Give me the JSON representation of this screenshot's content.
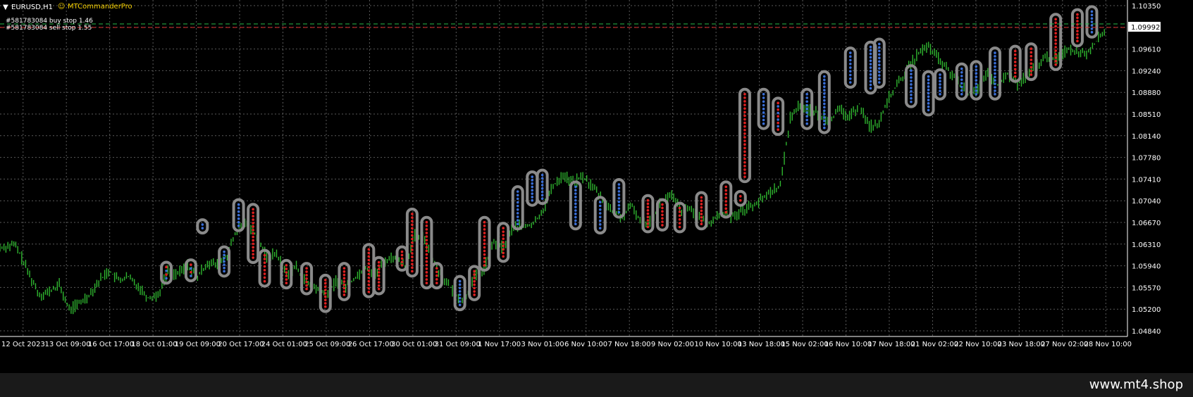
{
  "header": {
    "symbol_label": "EURUSD,H1",
    "ea_label": "MTCommanderPro",
    "ea_icon": "expert-advisor-face-icon"
  },
  "orders": [
    {
      "text": "#581783084 buy stop 1.46",
      "price": 1.1004,
      "color": "#27b84a"
    },
    {
      "text": "#581783084 sell stop 1.55",
      "price": 1.0998,
      "color": "#e03030"
    }
  ],
  "current_price": "1.09992",
  "watermark": "www.mt4.shop",
  "colors": {
    "background": "#000000",
    "grid": "#5a5a5a",
    "candle": "#2fb52f",
    "buy": "#3a6fd8",
    "sell": "#e02020",
    "marker_ring": "#8a8a8a"
  },
  "chart_data": {
    "type": "candlestick",
    "symbol": "EURUSD",
    "timeframe": "H1",
    "ylim": [
      1.0484,
      1.1035
    ],
    "y_ticks": [
      "1.10350",
      "1.09960",
      "1.09610",
      "1.09240",
      "1.08880",
      "1.08510",
      "1.08140",
      "1.07780",
      "1.07410",
      "1.07040",
      "1.06670",
      "1.06310",
      "1.05940",
      "1.05570",
      "1.05200",
      "1.04840"
    ],
    "x_ticks": [
      "12 Oct 2023",
      "13 Oct 09:00",
      "16 Oct 17:00",
      "18 Oct 01:00",
      "19 Oct 09:00",
      "20 Oct 17:00",
      "24 Oct 01:00",
      "25 Oct 09:00",
      "26 Oct 17:00",
      "30 Oct 01:00",
      "31 Oct 09:00",
      "1 Nov 17:00",
      "3 Nov 01:00",
      "6 Nov 10:00",
      "7 Nov 18:00",
      "9 Nov 02:00",
      "10 Nov 10:00",
      "13 Nov 18:00",
      "15 Nov 02:00",
      "16 Nov 10:00",
      "17 Nov 18:00",
      "21 Nov 02:00",
      "22 Nov 10:00",
      "23 Nov 18:00",
      "27 Nov 02:00",
      "28 Nov 10:00"
    ],
    "price_path": [
      [
        0,
        1.0625
      ],
      [
        2,
        1.0615
      ],
      [
        1.5,
        1.063
      ],
      [
        3,
        1.0578
      ],
      [
        4,
        1.0545
      ],
      [
        5,
        1.055
      ],
      [
        6,
        1.0562
      ],
      [
        7,
        1.052
      ],
      [
        8,
        1.053
      ],
      [
        9,
        1.0545
      ],
      [
        10,
        1.0568
      ],
      [
        11,
        1.0586
      ],
      [
        12,
        1.057
      ],
      [
        13,
        1.0575
      ],
      [
        14,
        1.056
      ],
      [
        15,
        1.054
      ],
      [
        16,
        1.0545
      ],
      [
        17,
        1.0585
      ],
      [
        18,
        1.058
      ],
      [
        19,
        1.0595
      ],
      [
        20,
        1.0575
      ],
      [
        21,
        1.06
      ],
      [
        22,
        1.0595
      ],
      [
        23,
        1.0612
      ],
      [
        24,
        1.0655
      ],
      [
        25,
        1.0668
      ],
      [
        26,
        1.0645
      ],
      [
        27,
        1.0608
      ],
      [
        28,
        1.0615
      ],
      [
        29,
        1.058
      ],
      [
        30,
        1.0592
      ],
      [
        31,
        1.0565
      ],
      [
        32,
        1.0555
      ],
      [
        33,
        1.0543
      ],
      [
        34,
        1.0568
      ],
      [
        35,
        1.056
      ],
      [
        36,
        1.0575
      ],
      [
        37,
        1.0592
      ],
      [
        38,
        1.058
      ],
      [
        39,
        1.0603
      ],
      [
        40,
        1.061
      ],
      [
        41,
        1.0595
      ],
      [
        42,
        1.0645
      ],
      [
        43,
        1.064
      ],
      [
        44,
        1.0598
      ],
      [
        45,
        1.057
      ],
      [
        46,
        1.0548
      ],
      [
        47,
        1.0535
      ],
      [
        48,
        1.0575
      ],
      [
        49,
        1.0588
      ],
      [
        50,
        1.0635
      ],
      [
        51,
        1.0625
      ],
      [
        52,
        1.0662
      ],
      [
        53,
        1.066
      ],
      [
        54,
        1.0665
      ],
      [
        55,
        1.069
      ],
      [
        56,
        1.073
      ],
      [
        57,
        1.0748
      ],
      [
        58,
        1.0735
      ],
      [
        59,
        1.0745
      ],
      [
        60,
        1.0728
      ],
      [
        61,
        1.0708
      ],
      [
        62,
        1.0685
      ],
      [
        63,
        1.0678
      ],
      [
        64,
        1.0695
      ],
      [
        65,
        1.0665
      ],
      [
        66,
        1.0673
      ],
      [
        67,
        1.0705
      ],
      [
        68,
        1.0712
      ],
      [
        69,
        1.0688
      ],
      [
        70,
        1.069
      ],
      [
        71,
        1.067
      ],
      [
        72,
        1.0668
      ],
      [
        73,
        1.0684
      ],
      [
        74,
        1.0678
      ],
      [
        75,
        1.0686
      ],
      [
        76,
        1.0695
      ],
      [
        77,
        1.0705
      ],
      [
        78,
        1.072
      ],
      [
        79,
        1.073
      ],
      [
        80,
        1.0845
      ],
      [
        81,
        1.0868
      ],
      [
        82,
        1.0858
      ],
      [
        83,
        1.085
      ],
      [
        84,
        1.0842
      ],
      [
        85,
        1.0858
      ],
      [
        86,
        1.0845
      ],
      [
        87,
        1.0868
      ],
      [
        88,
        1.083
      ],
      [
        89,
        1.0835
      ],
      [
        90,
        1.088
      ],
      [
        91,
        1.0905
      ],
      [
        92,
        1.093
      ],
      [
        93,
        1.0955
      ],
      [
        94,
        1.0965
      ],
      [
        95,
        1.0945
      ],
      [
        96,
        1.0925
      ],
      [
        97,
        1.0905
      ],
      [
        98,
        1.0885
      ],
      [
        99,
        1.0895
      ],
      [
        100,
        1.0918
      ],
      [
        101,
        1.09
      ],
      [
        102,
        1.092
      ],
      [
        103,
        1.0902
      ],
      [
        104,
        1.0915
      ],
      [
        105,
        1.0935
      ],
      [
        106,
        1.0948
      ],
      [
        107,
        1.0945
      ],
      [
        108,
        1.0962
      ],
      [
        109,
        1.0958
      ],
      [
        110,
        1.0955
      ],
      [
        111,
        1.0975
      ],
      [
        112,
        1.0996
      ]
    ],
    "markers": [
      {
        "x": 11.5,
        "y1": 1.0573,
        "y2": 1.0592,
        "side": "mixed"
      },
      {
        "x": 13.2,
        "y1": 1.0577,
        "y2": 1.0596,
        "side": "mixed"
      },
      {
        "x": 14,
        "y1": 1.0658,
        "y2": 1.0664,
        "side": "buy"
      },
      {
        "x": 15.5,
        "y1": 1.0585,
        "y2": 1.0618,
        "side": "buy"
      },
      {
        "x": 16.5,
        "y1": 1.0662,
        "y2": 1.0698,
        "side": "buy"
      },
      {
        "x": 17.5,
        "y1": 1.0608,
        "y2": 1.069,
        "side": "sell"
      },
      {
        "x": 18.3,
        "y1": 1.0568,
        "y2": 1.0612,
        "side": "sell"
      },
      {
        "x": 19.8,
        "y1": 1.0565,
        "y2": 1.0595,
        "side": "sell"
      },
      {
        "x": 21.2,
        "y1": 1.0555,
        "y2": 1.059,
        "side": "sell"
      },
      {
        "x": 22.5,
        "y1": 1.0525,
        "y2": 1.057,
        "side": "sell"
      },
      {
        "x": 23.8,
        "y1": 1.0545,
        "y2": 1.059,
        "side": "sell"
      },
      {
        "x": 25.5,
        "y1": 1.055,
        "y2": 1.0622,
        "side": "sell"
      },
      {
        "x": 26.2,
        "y1": 1.0555,
        "y2": 1.06,
        "side": "sell"
      },
      {
        "x": 27.8,
        "y1": 1.0595,
        "y2": 1.0618,
        "side": "sell"
      },
      {
        "x": 28.5,
        "y1": 1.0585,
        "y2": 1.0682,
        "side": "sell"
      },
      {
        "x": 29.5,
        "y1": 1.0565,
        "y2": 1.0668,
        "side": "sell"
      },
      {
        "x": 30.2,
        "y1": 1.0565,
        "y2": 1.059,
        "side": "sell"
      },
      {
        "x": 31.8,
        "y1": 1.0528,
        "y2": 1.0568,
        "side": "buy"
      },
      {
        "x": 32.8,
        "y1": 1.0545,
        "y2": 1.0585,
        "side": "sell"
      },
      {
        "x": 33.5,
        "y1": 1.0595,
        "y2": 1.0668,
        "side": "sell"
      },
      {
        "x": 34.8,
        "y1": 1.061,
        "y2": 1.0658,
        "side": "sell"
      },
      {
        "x": 35.8,
        "y1": 1.0665,
        "y2": 1.072,
        "side": "buy"
      },
      {
        "x": 36.8,
        "y1": 1.0705,
        "y2": 1.0745,
        "side": "buy"
      },
      {
        "x": 37.5,
        "y1": 1.0708,
        "y2": 1.0748,
        "side": "buy"
      },
      {
        "x": 39.8,
        "y1": 1.0665,
        "y2": 1.0728,
        "side": "buy"
      },
      {
        "x": 41.5,
        "y1": 1.0658,
        "y2": 1.0702,
        "side": "buy"
      },
      {
        "x": 42.8,
        "y1": 1.0685,
        "y2": 1.0732,
        "side": "buy"
      },
      {
        "x": 44.8,
        "y1": 1.066,
        "y2": 1.0705,
        "side": "sell"
      },
      {
        "x": 45.8,
        "y1": 1.0663,
        "y2": 1.0698,
        "side": "sell"
      },
      {
        "x": 47,
        "y1": 1.066,
        "y2": 1.0692,
        "side": "sell"
      },
      {
        "x": 48.5,
        "y1": 1.0665,
        "y2": 1.071,
        "side": "sell"
      },
      {
        "x": 50.2,
        "y1": 1.0685,
        "y2": 1.0728,
        "side": "sell"
      },
      {
        "x": 51.2,
        "y1": 1.0705,
        "y2": 1.0712,
        "side": "sell"
      },
      {
        "x": 51.5,
        "y1": 1.0745,
        "y2": 1.0885,
        "side": "sell"
      },
      {
        "x": 52.8,
        "y1": 1.0835,
        "y2": 1.0885,
        "side": "buy"
      },
      {
        "x": 53.8,
        "y1": 1.0825,
        "y2": 1.087,
        "side": "mixed"
      },
      {
        "x": 55.8,
        "y1": 1.0835,
        "y2": 1.0885,
        "side": "buy"
      },
      {
        "x": 57,
        "y1": 1.0828,
        "y2": 1.0915,
        "side": "buy"
      },
      {
        "x": 58.8,
        "y1": 1.0905,
        "y2": 1.0955,
        "side": "buy"
      },
      {
        "x": 60.2,
        "y1": 1.0895,
        "y2": 1.0965,
        "side": "buy"
      },
      {
        "x": 60.8,
        "y1": 1.0905,
        "y2": 1.097,
        "side": "buy"
      },
      {
        "x": 63,
        "y1": 1.0872,
        "y2": 1.0925,
        "side": "buy"
      },
      {
        "x": 64.2,
        "y1": 1.0858,
        "y2": 1.0915,
        "side": "buy"
      },
      {
        "x": 65,
        "y1": 1.0885,
        "y2": 1.0918,
        "side": "buy"
      },
      {
        "x": 66.5,
        "y1": 1.0885,
        "y2": 1.0928,
        "side": "buy"
      },
      {
        "x": 67.5,
        "y1": 1.0885,
        "y2": 1.0932,
        "side": "buy"
      },
      {
        "x": 68.8,
        "y1": 1.0885,
        "y2": 1.0955,
        "side": "buy"
      },
      {
        "x": 70.2,
        "y1": 1.0915,
        "y2": 1.0958,
        "side": "sell"
      },
      {
        "x": 71.3,
        "y1": 1.0918,
        "y2": 1.0962,
        "side": "sell"
      },
      {
        "x": 73,
        "y1": 1.0935,
        "y2": 1.1012,
        "side": "sell"
      },
      {
        "x": 74.5,
        "y1": 1.0975,
        "y2": 1.102,
        "side": "sell"
      },
      {
        "x": 75.5,
        "y1": 1.099,
        "y2": 1.1025,
        "side": "buy"
      }
    ]
  }
}
